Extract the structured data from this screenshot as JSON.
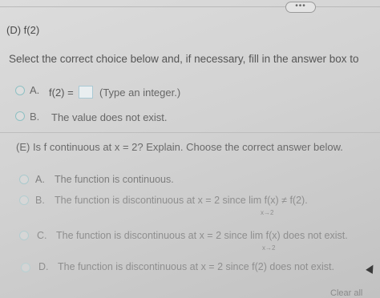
{
  "toolbar": {
    "more_label": "•••"
  },
  "part_d": {
    "label": "(D) f(2)"
  },
  "instruction": "Select the correct choice below and, if necessary, fill in the answer box to",
  "d_options": [
    {
      "letter": "A.",
      "prefix": "f(2) =",
      "hint": "(Type an integer.)"
    },
    {
      "letter": "B.",
      "text": "The value does not exist."
    }
  ],
  "part_e": {
    "question": "(E) Is f continuous at x = 2? Explain. Choose the correct answer below."
  },
  "e_options": [
    {
      "letter": "A.",
      "text": "The function is continuous."
    },
    {
      "letter": "B.",
      "text": "The function is discontinuous at x = 2 since  lim  f(x) ≠ f(2).",
      "sub": "x→2"
    },
    {
      "letter": "C.",
      "text": "The function is discontinuous at x = 2 since  lim  f(x) does not exist.",
      "sub": "x→2"
    },
    {
      "letter": "D.",
      "text": "The function is discontinuous at x = 2 since f(2) does not exist."
    }
  ],
  "footer": {
    "button_label": "Clear all"
  }
}
